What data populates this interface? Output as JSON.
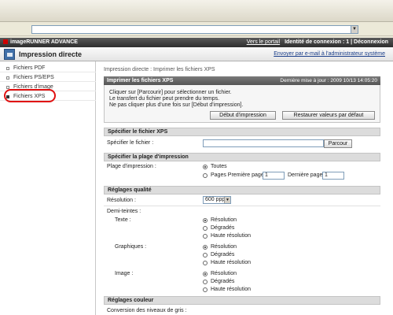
{
  "browser": {
    "address_dropdown": "▼"
  },
  "header": {
    "logo": "imageRUNNER ADVANCE",
    "portal_link": "Vers le portail",
    "login_label": "Identité de connexion :",
    "login_id": "1",
    "logout": "Déconnexion"
  },
  "titlebar": {
    "title": "Impression directe",
    "email_link": "Envoyer par e-mail à l'administrateur système"
  },
  "sidebar": {
    "items": [
      {
        "label": "Fichiers PDF"
      },
      {
        "label": "Fichiers PS/EPS"
      },
      {
        "label": "Fichiers d'image"
      },
      {
        "label": "Fichiers XPS"
      }
    ]
  },
  "content": {
    "breadcrumb": "Impression directe : Imprimer les fichiers XPS",
    "panel_title": "Imprimer les fichiers XPS",
    "last_update": "Dernière mise à jour : 2009 10/13 14:05:20",
    "desc": [
      "Cliquer sur [Parcourir] pour sélectionner un fichier.",
      "Le transfert du fichier peut prendre du temps.",
      "Ne pas cliquer plus d'une fois sur [Début d'impression]."
    ],
    "start_button": "Début d'impression",
    "restore_button": "Restaurer valeurs par défaut",
    "file_section": "Spécifier le fichier XPS",
    "file_label": "Spécifier le fichier :",
    "file_value": "",
    "browse_button": "Parcour",
    "range_section": "Spécifier la plage d'impression",
    "range_label": "Plage d'impression :",
    "range_all": "Toutes",
    "range_pages": "Pages Première page :",
    "first_page": "1",
    "last_page_label": "Dernière page :",
    "last_page": "1",
    "quality_section": "Réglages qualité",
    "resolution_label": "Résolution :",
    "resolution_value": "600 ppp",
    "halftone_label": "Demi-teintes :",
    "text_label": "Texte :",
    "graphics_label": "Graphiques :",
    "image_label": "Image :",
    "opt_resolution": "Résolution",
    "opt_gradation": "Dégradés",
    "opt_high_res": "Haute résolution",
    "color_section": "Réglages couleur",
    "gray_conversion_label": "Conversion des niveaux de gris :"
  }
}
